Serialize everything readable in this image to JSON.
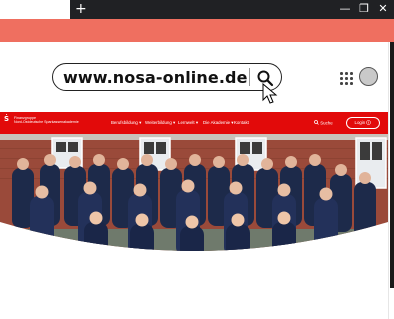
{
  "browser": {
    "new_tab_symbol": "+",
    "controls": {
      "minimize": "—",
      "restore": "❐",
      "close": "✕"
    }
  },
  "search_bar": {
    "url": "www.nosa-online.de"
  },
  "nav": {
    "brand_line1": "Finanzgruppe",
    "brand_line2": "Nord-Ostdeutsche Sparkassenakademie",
    "items": [
      {
        "label": "Berufsbildung ▾"
      },
      {
        "label": "Weiterbildung ▾"
      },
      {
        "label": "Lernwelt ▾"
      },
      {
        "label": "Die Akademie ▾"
      },
      {
        "label": "Kontakt"
      }
    ],
    "search_label": "Suche",
    "login_label": "Login"
  },
  "colors": {
    "brand_red": "#e20a0a",
    "header_salmon": "#ef6f60",
    "chrome_dark": "#202124"
  },
  "icons": [
    "search-icon",
    "apps-grid-icon",
    "avatar-icon",
    "login-arrow-icon",
    "mouse-cursor-icon"
  ]
}
